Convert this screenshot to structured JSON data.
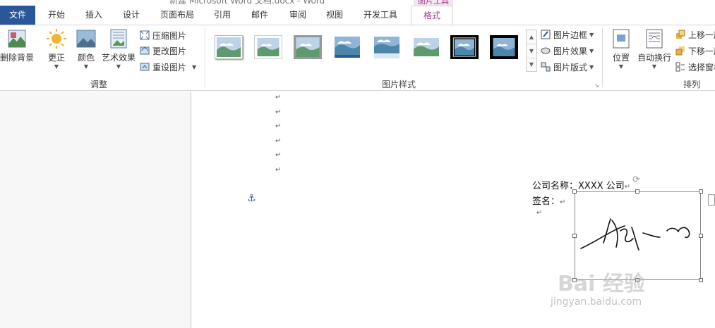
{
  "window": {
    "title": "新建 Microsoft Word 文档.docx - Word"
  },
  "context_group": "图片工具",
  "tabs": [
    "文件",
    "开始",
    "插入",
    "设计",
    "页面布局",
    "引用",
    "邮件",
    "审阅",
    "视图",
    "开发工具",
    "格式"
  ],
  "active_tab": "格式",
  "ribbon": {
    "adjust": {
      "label": "调整",
      "remove_bg": "删除背景",
      "corrections": "更正",
      "color": "颜色",
      "artistic": "艺术效果",
      "compress": "压缩图片",
      "change": "更改图片",
      "reset": "重设图片"
    },
    "styles": {
      "label": "图片样式",
      "border": "图片边框",
      "effects": "图片效果",
      "layout": "图片版式"
    },
    "arrange": {
      "label": "排列",
      "position": "位置",
      "wrap": "自动换行",
      "forward": "上移一层",
      "backward": "下移一层",
      "selection": "选择窗格"
    }
  },
  "document": {
    "para_mark": "↵",
    "company_line": "公司名称：XXXX 公司",
    "sign_line": "签名："
  },
  "watermark": {
    "brand": "Bai 经验",
    "url": "jingyan.baidu.com"
  },
  "colors": {
    "file_tab": "#2b579a",
    "format_tab": "#a23b8a"
  }
}
